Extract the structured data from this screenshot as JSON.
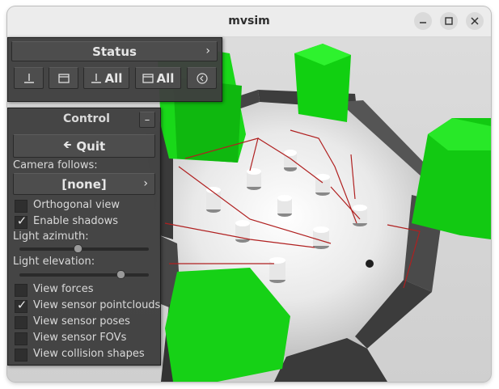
{
  "window": {
    "title": "mvsim"
  },
  "status_panel": {
    "title": "Status",
    "buttons": [
      {
        "label": "",
        "icon": "download-icon"
      },
      {
        "label": "",
        "icon": "window-icon"
      },
      {
        "label": "All",
        "icon": "download-icon"
      },
      {
        "label": "All",
        "icon": "window-icon"
      },
      {
        "label": "",
        "icon": "back-circle-icon"
      }
    ]
  },
  "control_panel": {
    "title": "Control",
    "minimize": "–",
    "quit_label": "Quit",
    "camera_follows_label": "Camera follows:",
    "camera_follows_value": "[none]",
    "orthogonal_view": {
      "label": "Orthogonal view",
      "checked": false
    },
    "enable_shadows": {
      "label": "Enable shadows",
      "checked": true
    },
    "light_azimuth": {
      "label": "Light azimuth:",
      "value": 0.45
    },
    "light_elevation": {
      "label": "Light elevation:",
      "value": 0.78
    },
    "view_forces": {
      "label": "View forces",
      "checked": false
    },
    "view_sensor_pointclouds": {
      "label": "View sensor pointclouds",
      "checked": true
    },
    "view_sensor_poses": {
      "label": "View sensor poses",
      "checked": false
    },
    "view_sensor_fovs": {
      "label": "View sensor FOVs",
      "checked": false
    },
    "view_collision_shapes": {
      "label": "View collision shapes",
      "checked": false
    }
  }
}
